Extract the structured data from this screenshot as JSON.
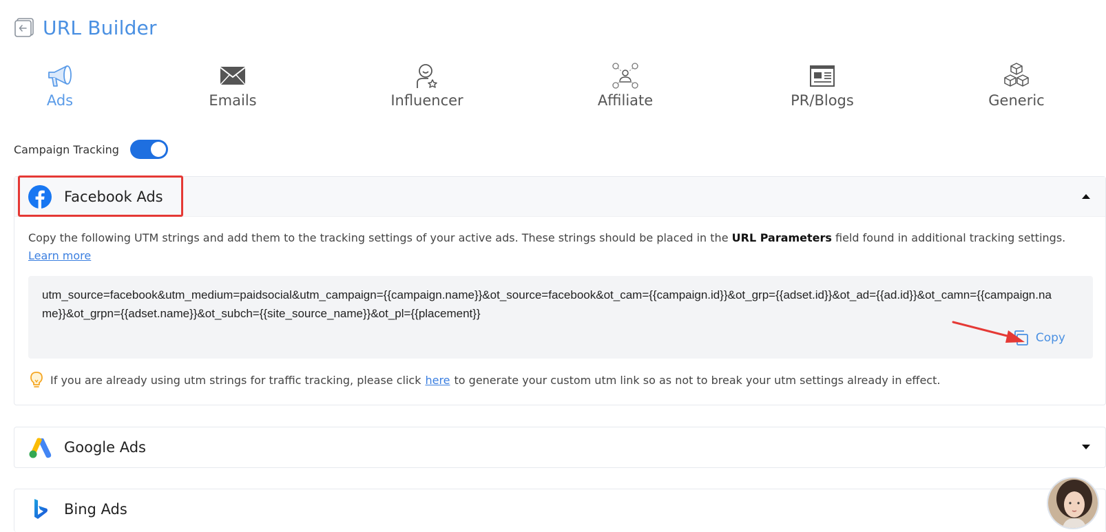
{
  "header": {
    "title": "URL Builder",
    "back_icon": "back-arrow-icon"
  },
  "tabs": [
    {
      "label": "Ads",
      "icon": "megaphone-icon",
      "active": true
    },
    {
      "label": "Emails",
      "icon": "envelope-icon",
      "active": false
    },
    {
      "label": "Influencer",
      "icon": "influencer-icon",
      "active": false
    },
    {
      "label": "Affiliate",
      "icon": "affiliate-network-icon",
      "active": false
    },
    {
      "label": "PR/Blogs",
      "icon": "newspaper-icon",
      "active": false
    },
    {
      "label": "Generic",
      "icon": "cubes-icon",
      "active": false
    }
  ],
  "tracking": {
    "label": "Campaign Tracking",
    "enabled": true
  },
  "facebook": {
    "title": "Facebook Ads",
    "expanded": true,
    "desc_pre": "Copy the following UTM strings and add them to the tracking settings of your active ads. These strings should be placed in the",
    "desc_bold": "URL Parameters",
    "desc_post": "field found in additional tracking settings.",
    "learn_more": "Learn more",
    "utm_string": "utm_source=facebook&utm_medium=paidsocial&utm_campaign={{campaign.name}}&ot_source=facebook&ot_cam={{campaign.id}}&ot_grp={{adset.id}}&ot_ad={{ad.id}}&ot_camn={{campaign.name}}&ot_grpn={{adset.name}}&ot_subch={{site_source_name}}&ot_pl={{placement}}",
    "copy_label": "Copy",
    "hint_pre": "If you are already using utm strings for traffic tracking, please click",
    "hint_link": "here",
    "hint_post": "to generate your custom utm link so as not to break your utm settings already in effect."
  },
  "google": {
    "title": "Google Ads",
    "expanded": false
  },
  "bing": {
    "title": "Bing Ads",
    "expanded": false
  },
  "colors": {
    "accent": "#4a90e2",
    "toggle": "#1e6fe0",
    "highlight": "#e53935",
    "facebook": "#1877f2"
  }
}
